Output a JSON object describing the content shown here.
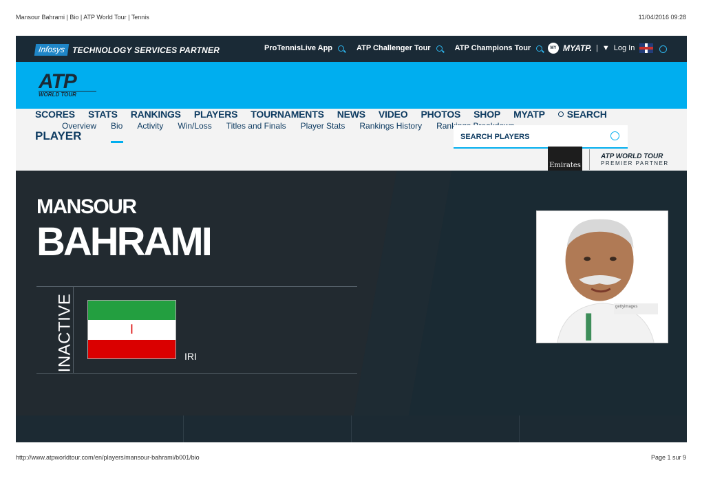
{
  "print": {
    "title": "Mansour Bahrami | Bio | ATP World Tour | Tennis",
    "datetime": "11/04/2016 09:28",
    "url": "http://www.atpworldtour.com/en/players/mansour-bahrami/b001/bio",
    "page": "Page 1 sur 9"
  },
  "topbar": {
    "sponsor_logo": "Infosys",
    "sponsor_tagline": "TECHNOLOGY SERVICES PARTNER",
    "links": [
      "ProTennisLive App",
      "ATP Challenger Tour",
      "ATP Champions Tour"
    ],
    "myatp": "MYATP.",
    "login": "Log In"
  },
  "logo": {
    "big": "ATP",
    "small": "WORLD TOUR"
  },
  "nav": {
    "items": [
      "SCORES",
      "STATS",
      "RANKINGS",
      "PLAYERS",
      "TOURNAMENTS",
      "NEWS",
      "VIDEO",
      "PHOTOS",
      "SHOP",
      "MYATP"
    ],
    "search": "SEARCH"
  },
  "subnav": {
    "section": "PLAYER",
    "items": [
      "Overview",
      "Bio",
      "Activity",
      "Win/Loss",
      "Titles and Finals",
      "Player Stats",
      "Rankings History",
      "Rankings Breakdown"
    ],
    "active": "Bio"
  },
  "search_players": {
    "placeholder": "SEARCH PLAYERS"
  },
  "partner": {
    "brand": "Emirates",
    "line1": "ATP WORLD TOUR",
    "line2": "PREMIER PARTNER"
  },
  "player": {
    "first_name": "MANSOUR",
    "last_name": "BAHRAMI",
    "status": "INACTIVE",
    "country": "IRI"
  },
  "colors": {
    "accent": "#00aeef",
    "navy": "#0f3c62",
    "dark": "#1a2a36"
  }
}
